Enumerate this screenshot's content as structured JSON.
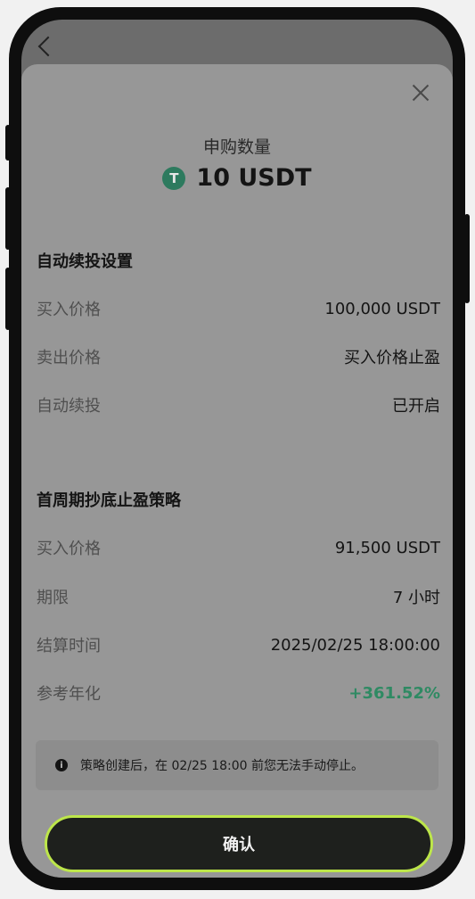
{
  "header": {
    "amount_label": "申购数量",
    "amount": "10 USDT",
    "coin_symbol": "T"
  },
  "auto_reinvest": {
    "title": "自动续投设置",
    "rows": [
      {
        "label": "买入价格",
        "value": "100,000 USDT"
      },
      {
        "label": "卖出价格",
        "value": "买入价格止盈"
      },
      {
        "label": "自动续投",
        "value": "已开启"
      }
    ]
  },
  "strategy": {
    "title": "首周期抄底止盈策略",
    "rows": [
      {
        "label": "买入价格",
        "value": "91,500 USDT"
      },
      {
        "label": "期限",
        "value": "7 小时"
      },
      {
        "label": "结算时间",
        "value": "2025/02/25 18:00:00"
      },
      {
        "label": "参考年化",
        "value": "+361.52%"
      }
    ]
  },
  "notice": {
    "text": "策略创建后，在 02/25 18:00 前您无法手动停止。",
    "icon": "i"
  },
  "confirm_label": "确认",
  "colors": {
    "accent_border": "#bde64a",
    "positive": "#2f8a63",
    "coin": "#2d7a5e"
  }
}
